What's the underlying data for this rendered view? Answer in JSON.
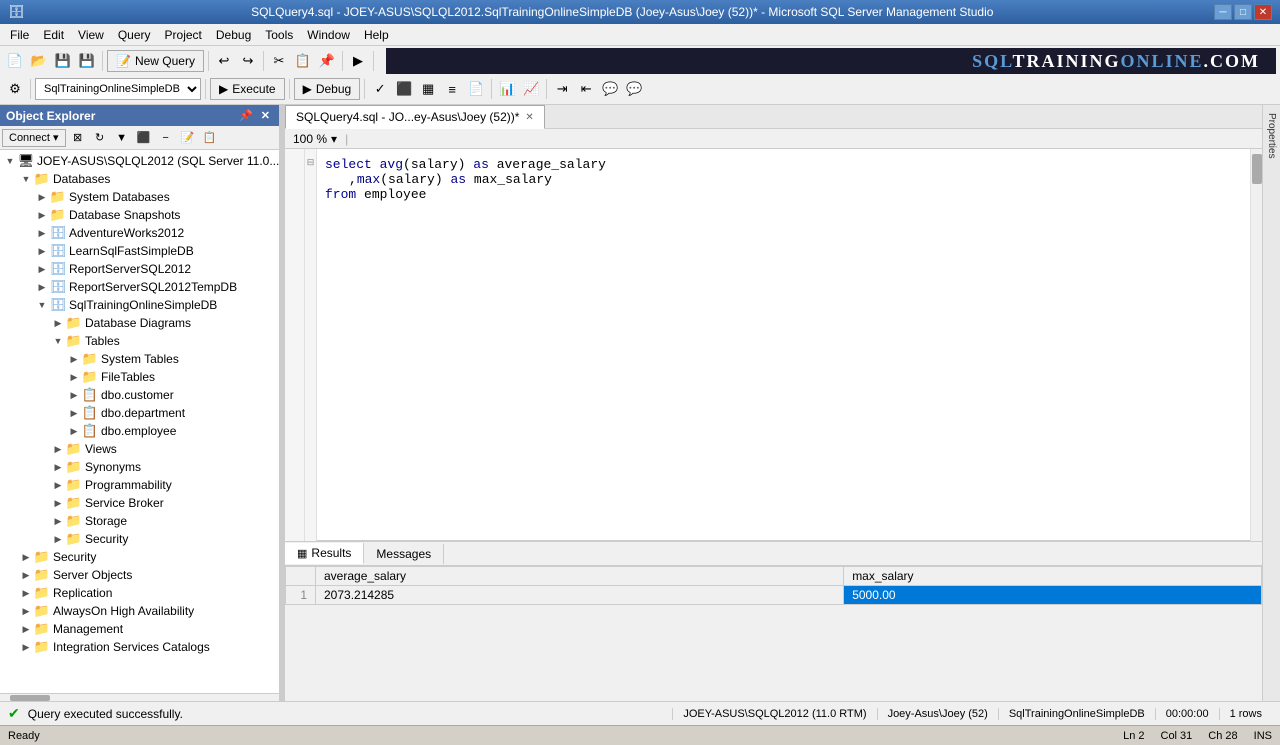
{
  "titleBar": {
    "title": "SQLQuery4.sql - JOEY-ASUS\\SQLQL2012.SqlTrainingOnlineSimpleDB (Joey-Asus\\Joey (52))* - Microsoft SQL Server Management Studio",
    "minBtn": "─",
    "maxBtn": "□",
    "closeBtn": "✕"
  },
  "menu": {
    "items": [
      "File",
      "Edit",
      "View",
      "Query",
      "Project",
      "Debug",
      "Tools",
      "Window",
      "Help"
    ]
  },
  "toolbar": {
    "newQueryLabel": "New Query",
    "executeLabel": "Execute",
    "debugLabel": "Debug",
    "dbDropdown": "SqlTrainingOnlineSimpleDB"
  },
  "objectExplorer": {
    "title": "Object Explorer",
    "connectBtn": "Connect ▾",
    "tree": [
      {
        "level": 0,
        "expanded": true,
        "icon": "🖥",
        "label": "JOEY-ASUS\\SQLQL2012 (SQL Server 11.0...)",
        "type": "server"
      },
      {
        "level": 1,
        "expanded": true,
        "icon": "📁",
        "label": "Databases",
        "type": "folder"
      },
      {
        "level": 2,
        "expanded": false,
        "icon": "📁",
        "label": "System Databases",
        "type": "folder"
      },
      {
        "level": 2,
        "expanded": false,
        "icon": "📁",
        "label": "Database Snapshots",
        "type": "folder"
      },
      {
        "level": 2,
        "expanded": false,
        "icon": "🗄",
        "label": "AdventureWorks2012",
        "type": "db"
      },
      {
        "level": 2,
        "expanded": false,
        "icon": "🗄",
        "label": "LearnSqlFastSimpleDB",
        "type": "db"
      },
      {
        "level": 2,
        "expanded": false,
        "icon": "🗄",
        "label": "ReportServerSQL2012",
        "type": "db"
      },
      {
        "level": 2,
        "expanded": false,
        "icon": "🗄",
        "label": "ReportServerSQL2012TempDB",
        "type": "db"
      },
      {
        "level": 2,
        "expanded": true,
        "icon": "🗄",
        "label": "SqlTrainingOnlineSimpleDB",
        "type": "db"
      },
      {
        "level": 3,
        "expanded": false,
        "icon": "📁",
        "label": "Database Diagrams",
        "type": "folder"
      },
      {
        "level": 3,
        "expanded": true,
        "icon": "📁",
        "label": "Tables",
        "type": "folder"
      },
      {
        "level": 4,
        "expanded": false,
        "icon": "📁",
        "label": "System Tables",
        "type": "folder"
      },
      {
        "level": 4,
        "expanded": false,
        "icon": "📁",
        "label": "FileTables",
        "type": "folder"
      },
      {
        "level": 4,
        "expanded": false,
        "icon": "📋",
        "label": "dbo.customer",
        "type": "table"
      },
      {
        "level": 4,
        "expanded": false,
        "icon": "📋",
        "label": "dbo.department",
        "type": "table"
      },
      {
        "level": 4,
        "expanded": false,
        "icon": "📋",
        "label": "dbo.employee",
        "type": "table"
      },
      {
        "level": 3,
        "expanded": false,
        "icon": "📁",
        "label": "Views",
        "type": "folder"
      },
      {
        "level": 3,
        "expanded": false,
        "icon": "📁",
        "label": "Synonyms",
        "type": "folder"
      },
      {
        "level": 3,
        "expanded": false,
        "icon": "📁",
        "label": "Programmability",
        "type": "folder"
      },
      {
        "level": 3,
        "expanded": false,
        "icon": "📁",
        "label": "Service Broker",
        "type": "folder"
      },
      {
        "level": 3,
        "expanded": false,
        "icon": "📁",
        "label": "Storage",
        "type": "folder"
      },
      {
        "level": 3,
        "expanded": false,
        "icon": "📁",
        "label": "Security",
        "type": "folder"
      },
      {
        "level": 1,
        "expanded": false,
        "icon": "📁",
        "label": "Security",
        "type": "folder"
      },
      {
        "level": 1,
        "expanded": false,
        "icon": "📁",
        "label": "Server Objects",
        "type": "folder"
      },
      {
        "level": 1,
        "expanded": false,
        "icon": "📁",
        "label": "Replication",
        "type": "folder"
      },
      {
        "level": 1,
        "expanded": false,
        "icon": "📁",
        "label": "AlwaysOn High Availability",
        "type": "folder"
      },
      {
        "level": 1,
        "expanded": false,
        "icon": "📁",
        "label": "Management",
        "type": "folder"
      },
      {
        "level": 1,
        "expanded": false,
        "icon": "📁",
        "label": "Integration Services Catalogs",
        "type": "folder"
      }
    ]
  },
  "editor": {
    "tab": "SQLQuery4.sql - JO...ey-Asus\\Joey (52))*",
    "code": [
      {
        "collapse": true,
        "line": "select avg(salary) as average_salary"
      },
      {
        "collapse": false,
        "line": "      ,max(salary) as max_salary"
      },
      {
        "collapse": false,
        "line": "from employee"
      }
    ],
    "zoom": "100 %"
  },
  "results": {
    "tabs": [
      "Results",
      "Messages"
    ],
    "activeTab": "Results",
    "gridIcon": "▦",
    "columns": [
      "",
      "average_salary",
      "max_salary"
    ],
    "rows": [
      {
        "num": "1",
        "average_salary": "2073.214285",
        "max_salary": "5000.00"
      }
    ]
  },
  "statusBar": {
    "message": "Query executed successfully.",
    "server": "JOEY-ASUS\\SQLQL2012 (11.0 RTM)",
    "user": "Joey-Asus\\Joey (52)",
    "db": "SqlTrainingOnlineSimpleDB",
    "time": "00:00:00",
    "rows": "1 rows",
    "ready": "Ready",
    "ln": "Ln 2",
    "col": "Col 31",
    "ch": "Ch 28",
    "ins": "INS"
  },
  "logo": {
    "text1": "SQL",
    "text2": "TRAINING",
    "text3": "ONLINE",
    "text4": ".COM"
  }
}
